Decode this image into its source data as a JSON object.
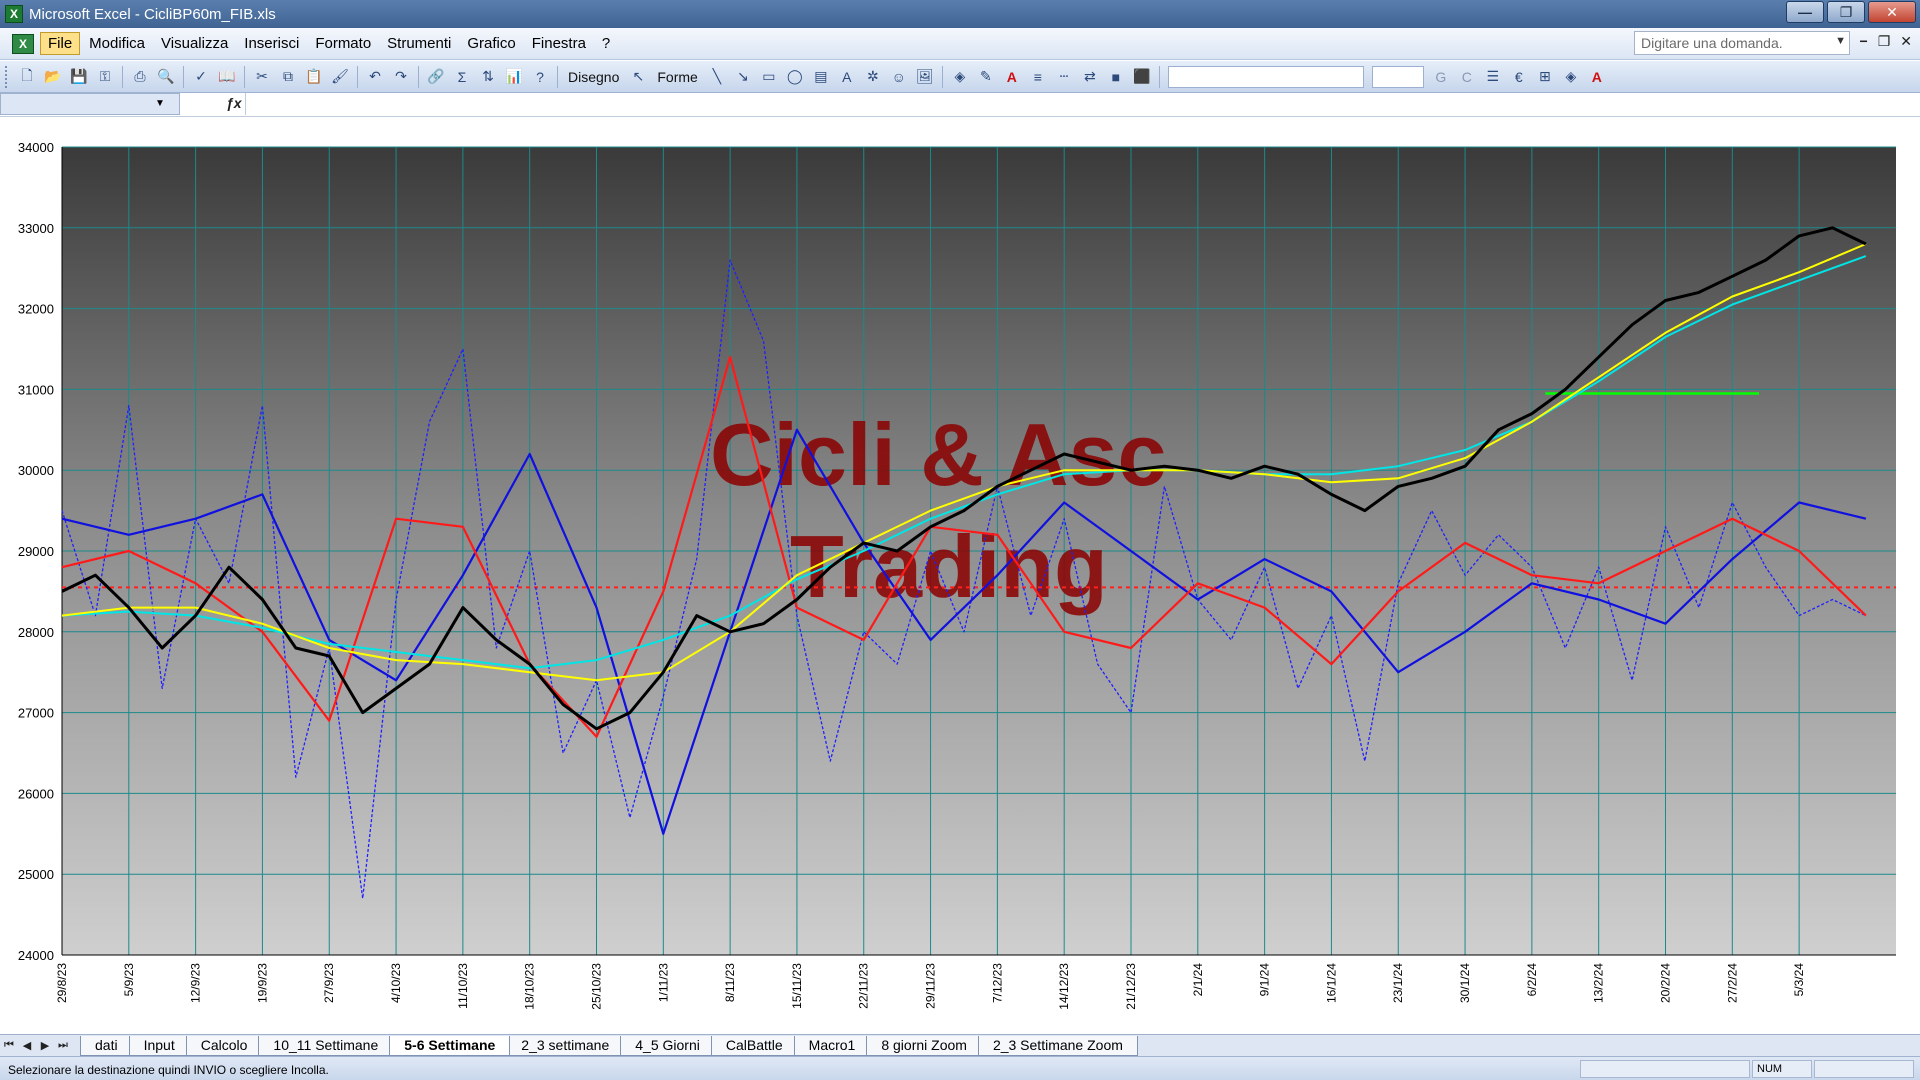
{
  "window": {
    "title": "Microsoft Excel - CicliBP60m_FIB.xls"
  },
  "menu": {
    "items": [
      "File",
      "Modifica",
      "Visualizza",
      "Inserisci",
      "Formato",
      "Strumenti",
      "Grafico",
      "Finestra",
      "?"
    ],
    "help_placeholder": "Digitare una domanda."
  },
  "toolbar": {
    "drawing_label": "Disegno",
    "shapes_label": "Forme"
  },
  "sheet_tabs": [
    "dati",
    "Input",
    "Calcolo",
    "10_11 Settimane",
    "5-6 Settimane",
    "2_3 settimane",
    "4_5 Giorni",
    "CalBattle",
    "Macro1",
    "8 giorni Zoom",
    "2_3 Settimane Zoom"
  ],
  "active_tab": "5-6 Settimane",
  "status": {
    "message": "Selezionare la destinazione quindi INVIO o scegliere Incolla.",
    "num": "NUM"
  },
  "watermark": {
    "line1": "Cicli & Asc",
    "line2": "Trading"
  },
  "colors": {
    "price": "#000000",
    "slow_ma": "#00e5e5",
    "mid_ma": "#ffff00",
    "red_cycle": "#ff1a1a",
    "blue_cycle": "#1010e0",
    "dotted_osc": "#2020ff",
    "level_line": "#00ff00",
    "ref_line": "#ff2020",
    "watermark": "#8b0000"
  },
  "chart_data": {
    "type": "line",
    "x_ticks": [
      "29/8/23",
      "5/9/23",
      "12/9/23",
      "19/9/23",
      "27/9/23",
      "4/10/23",
      "11/10/23",
      "18/10/23",
      "25/10/23",
      "1/11/23",
      "8/11/23",
      "15/11/23",
      "22/11/23",
      "29/11/23",
      "7/12/23",
      "14/12/23",
      "21/12/23",
      "2/1/24",
      "9/1/24",
      "16/1/24",
      "23/1/24",
      "30/1/24",
      "6/2/24",
      "13/2/24",
      "20/2/24",
      "27/2/24",
      "5/3/24"
    ],
    "y_ticks": [
      24000,
      25000,
      26000,
      27000,
      28000,
      29000,
      30000,
      31000,
      32000,
      33000,
      34000
    ],
    "ylim": [
      24000,
      34000
    ],
    "grid": true,
    "ref_level": 28550,
    "green_level": 30950,
    "green_range": [
      22.2,
      25.4
    ],
    "series": [
      {
        "key": "price",
        "x": [
          0,
          0.5,
          1,
          1.5,
          2,
          2.5,
          3,
          3.5,
          4,
          4.5,
          5,
          5.5,
          6,
          6.5,
          7,
          7.5,
          8,
          8.5,
          9,
          9.5,
          10,
          10.5,
          11,
          11.5,
          12,
          12.5,
          13,
          13.5,
          14,
          14.5,
          15,
          15.5,
          16,
          16.5,
          17,
          17.5,
          18,
          18.5,
          19,
          19.5,
          20,
          20.5,
          21,
          21.5,
          22,
          22.5,
          23,
          23.5,
          24,
          24.5,
          25,
          25.5,
          26,
          26.5,
          27
        ],
        "values": [
          28500,
          28700,
          28300,
          27800,
          28200,
          28800,
          28400,
          27800,
          27700,
          27000,
          27300,
          27600,
          28300,
          27900,
          27600,
          27100,
          26800,
          27000,
          27500,
          28200,
          28000,
          28100,
          28400,
          28800,
          29100,
          29000,
          29300,
          29500,
          29800,
          30000,
          30200,
          30100,
          30000,
          30050,
          30000,
          29900,
          30050,
          29950,
          29700,
          29500,
          29800,
          29900,
          30050,
          30500,
          30700,
          31000,
          31400,
          31800,
          32100,
          32200,
          32400,
          32600,
          32900,
          33000,
          32800
        ]
      },
      {
        "key": "slow_ma",
        "x": [
          0,
          1,
          2,
          3,
          4,
          5,
          6,
          7,
          8,
          9,
          10,
          11,
          12,
          13,
          14,
          15,
          16,
          17,
          18,
          19,
          20,
          21,
          22,
          23,
          24,
          25,
          26,
          27
        ],
        "values": [
          28200,
          28250,
          28200,
          28050,
          27850,
          27750,
          27650,
          27550,
          27650,
          27900,
          28200,
          28650,
          29000,
          29400,
          29700,
          29950,
          30000,
          30000,
          29950,
          29950,
          30050,
          30250,
          30600,
          31100,
          31650,
          32050,
          32350,
          32650
        ]
      },
      {
        "key": "mid_ma",
        "x": [
          0,
          1,
          2,
          3,
          4,
          5,
          6,
          7,
          8,
          9,
          10,
          11,
          12,
          13,
          14,
          15,
          16,
          17,
          18,
          19,
          20,
          21,
          22,
          23,
          24,
          25,
          26,
          27
        ],
        "values": [
          28200,
          28300,
          28300,
          28100,
          27800,
          27650,
          27600,
          27500,
          27400,
          27500,
          28000,
          28700,
          29100,
          29500,
          29800,
          30000,
          30000,
          30000,
          29950,
          29850,
          29900,
          30150,
          30600,
          31150,
          31700,
          32150,
          32450,
          32800
        ]
      },
      {
        "key": "red_cycle",
        "x": [
          0,
          1,
          2,
          3,
          4,
          5,
          6,
          7,
          8,
          9,
          10,
          11,
          12,
          13,
          14,
          15,
          16,
          17,
          18,
          19,
          20,
          21,
          22,
          23,
          24,
          25,
          26,
          27
        ],
        "values": [
          28800,
          29000,
          28600,
          28000,
          26900,
          29400,
          29300,
          27600,
          26700,
          28500,
          31400,
          28300,
          27900,
          29300,
          29200,
          28000,
          27800,
          28600,
          28300,
          27600,
          28500,
          29100,
          28700,
          28600,
          29000,
          29400,
          29000,
          28200
        ]
      },
      {
        "key": "blue_cycle",
        "x": [
          0,
          1,
          2,
          3,
          4,
          5,
          6,
          7,
          8,
          9,
          10,
          11,
          12,
          13,
          14,
          15,
          16,
          17,
          18,
          19,
          20,
          21,
          22,
          23,
          24,
          25,
          26,
          27
        ],
        "values": [
          29400,
          29200,
          29400,
          29700,
          27900,
          27400,
          28700,
          30200,
          28300,
          25500,
          28000,
          30500,
          29100,
          27900,
          28700,
          29600,
          29000,
          28400,
          28900,
          28500,
          27500,
          28000,
          28600,
          28400,
          28100,
          28900,
          29600,
          29400
        ]
      },
      {
        "key": "dotted_osc",
        "x": [
          0,
          0.5,
          1,
          1.5,
          2,
          2.5,
          3,
          3.5,
          4,
          4.5,
          5,
          5.5,
          6,
          6.5,
          7,
          7.5,
          8,
          8.5,
          9,
          9.5,
          10,
          10.5,
          11,
          11.5,
          12,
          12.5,
          13,
          13.5,
          14,
          14.5,
          15,
          15.5,
          16,
          16.5,
          17,
          17.5,
          18,
          18.5,
          19,
          19.5,
          20,
          20.5,
          21,
          21.5,
          22,
          22.5,
          23,
          23.5,
          24,
          24.5,
          25,
          25.5,
          26,
          26.5,
          27
        ],
        "values": [
          29500,
          28200,
          30800,
          27300,
          29400,
          28600,
          30800,
          26200,
          27800,
          24700,
          28400,
          30600,
          31500,
          27800,
          29000,
          26500,
          27400,
          25700,
          27200,
          28900,
          32600,
          31600,
          28200,
          26400,
          28000,
          27600,
          29000,
          28000,
          29800,
          28200,
          29400,
          27600,
          27000,
          29800,
          28400,
          27900,
          28800,
          27300,
          28200,
          26400,
          28600,
          29500,
          28700,
          29200,
          28800,
          27800,
          28800,
          27400,
          29300,
          28300,
          29600,
          28800,
          28200,
          28400,
          28200
        ]
      }
    ]
  }
}
